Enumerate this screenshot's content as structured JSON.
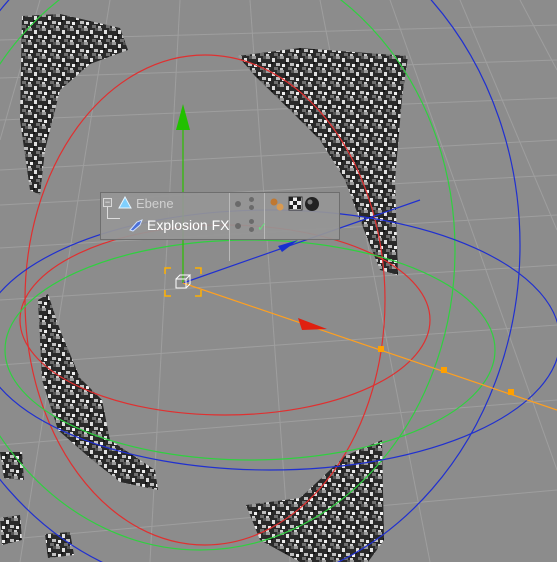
{
  "objects": [
    {
      "name": "Ebene",
      "expanded": true,
      "icon": "null-object-icon"
    },
    {
      "name": "Explosion FX",
      "icon": "explosion-fx-icon",
      "enabled": true
    }
  ],
  "tags": [
    "phong-tag-icon",
    "texture-tag-icon",
    "material-tag-icon"
  ],
  "colors": {
    "viewport_bg": "#8c8c8c",
    "grid": "#9e9e9e",
    "ring_red": "#e03030",
    "ring_green": "#30d040",
    "ring_blue": "#2030d0",
    "axis_y": "#22c000",
    "axis_z": "#1830d0",
    "axis_x": "#e02010",
    "selection": "#ffb000"
  }
}
